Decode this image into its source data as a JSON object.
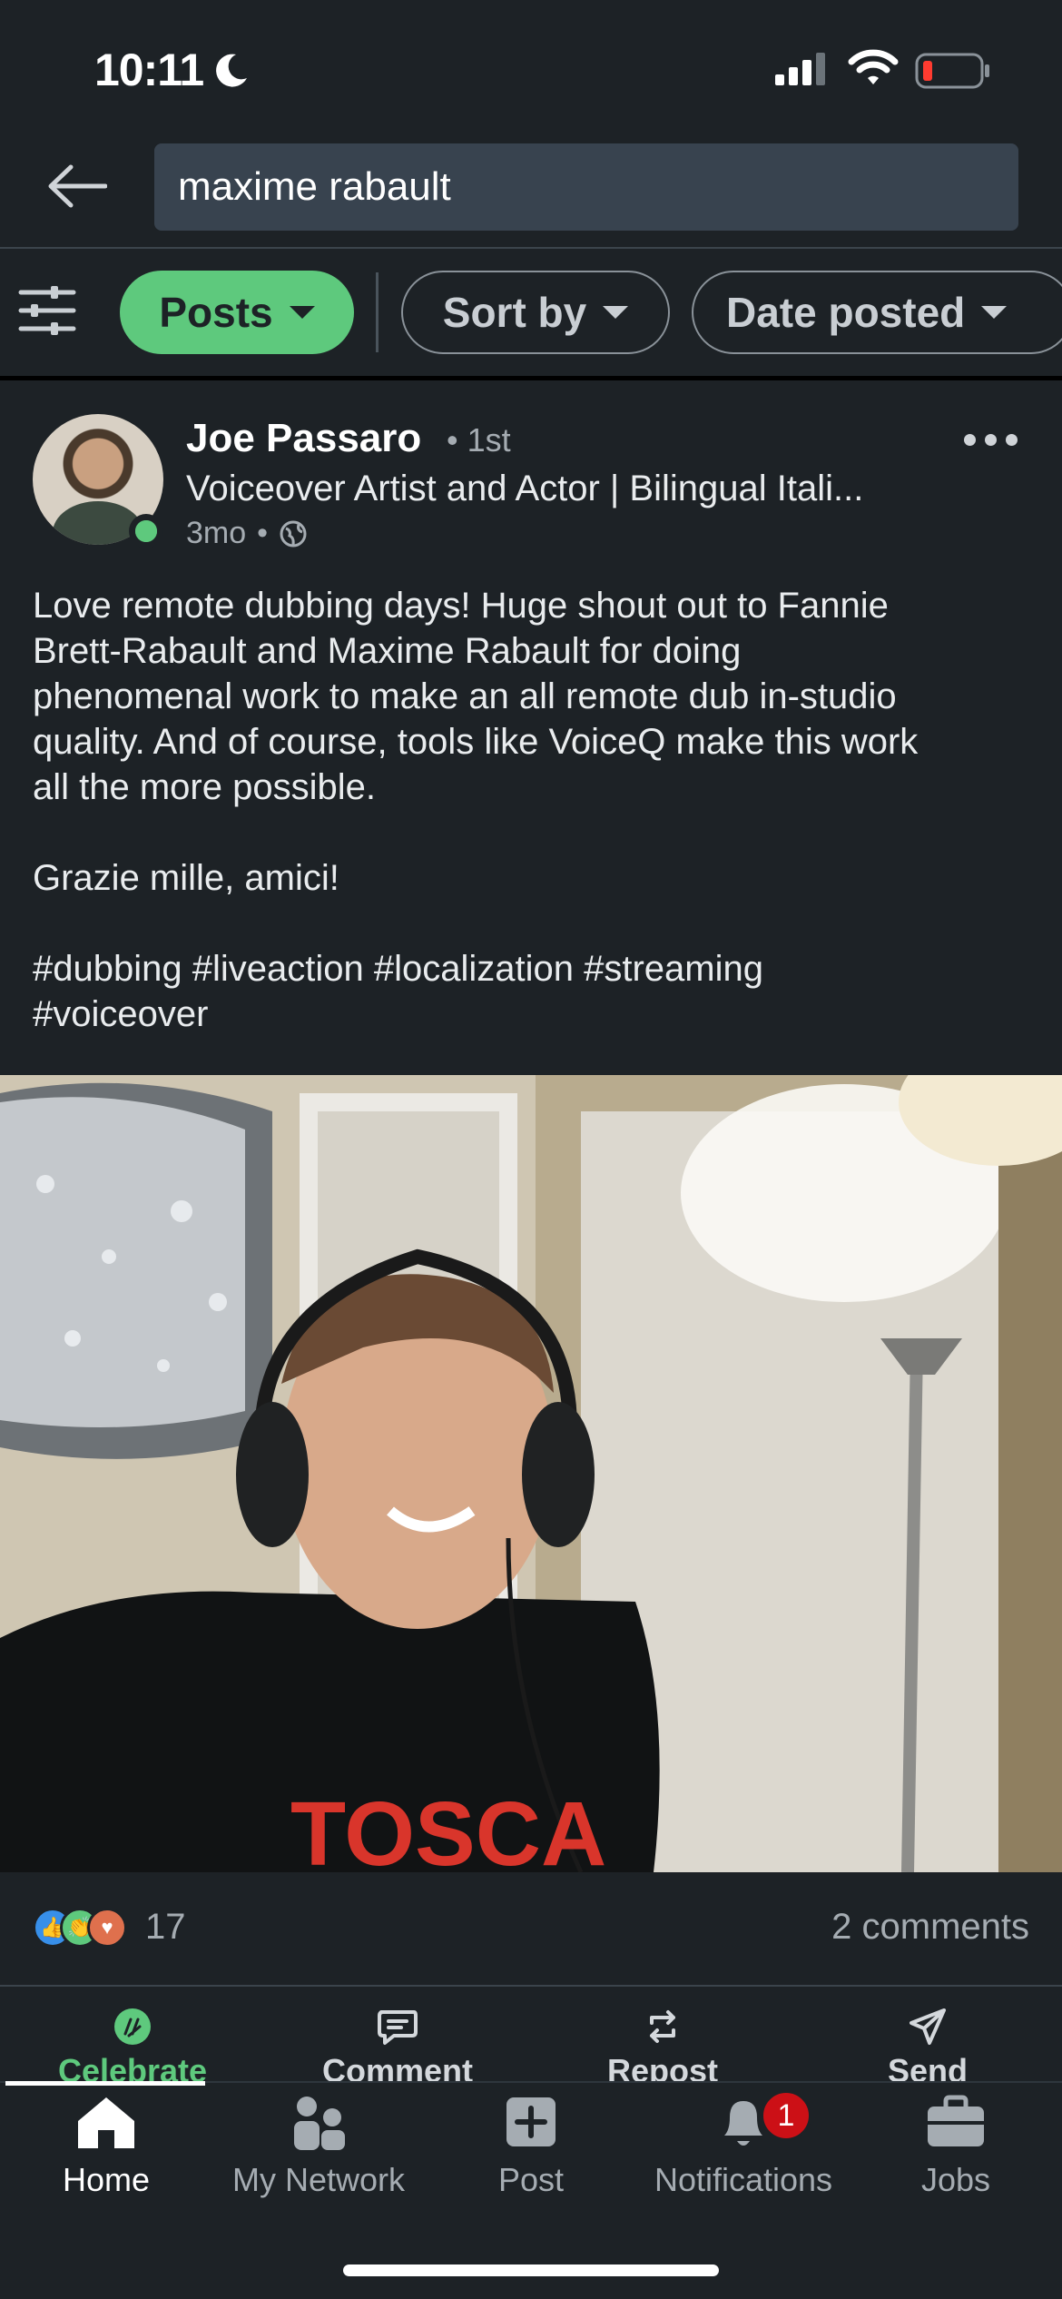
{
  "status_bar": {
    "time": "10:11"
  },
  "search": {
    "query": "maxime rabault"
  },
  "filters": {
    "posts": "Posts",
    "sort_by": "Sort by",
    "date_posted": "Date posted"
  },
  "post": {
    "author": "Joe Passaro",
    "degree": "• 1st",
    "headline": "Voiceover Artist and Actor | Bilingual Itali...",
    "age": "3mo",
    "meta_dot": "•",
    "body_lines": [
      "Love remote dubbing days! Huge shout out to Fannie",
      "Brett-Rabault and Maxime Rabault for doing",
      "phenomenal work to make an all remote dub in-studio",
      "quality. And of course, tools like VoiceQ make this work",
      "all the more possible."
    ],
    "thanks": "Grazie mille, amici!",
    "hashtags_line1": "#dubbing #liveaction #localization #streaming",
    "hashtags_line2": "#voiceover",
    "shirt_text": "TOSCA",
    "reactions_count": "17",
    "comments_count": "2 comments"
  },
  "actions": {
    "celebrate": "Celebrate",
    "comment": "Comment",
    "repost": "Repost",
    "send": "Send"
  },
  "nav": {
    "home": "Home",
    "network": "My Network",
    "post": "Post",
    "notifications": "Notifications",
    "notifications_badge": "1",
    "jobs": "Jobs"
  },
  "colors": {
    "accent_green": "#5ec97d",
    "background": "#1d2226",
    "search_bg": "#38434f",
    "badge_red": "#cc1016"
  }
}
